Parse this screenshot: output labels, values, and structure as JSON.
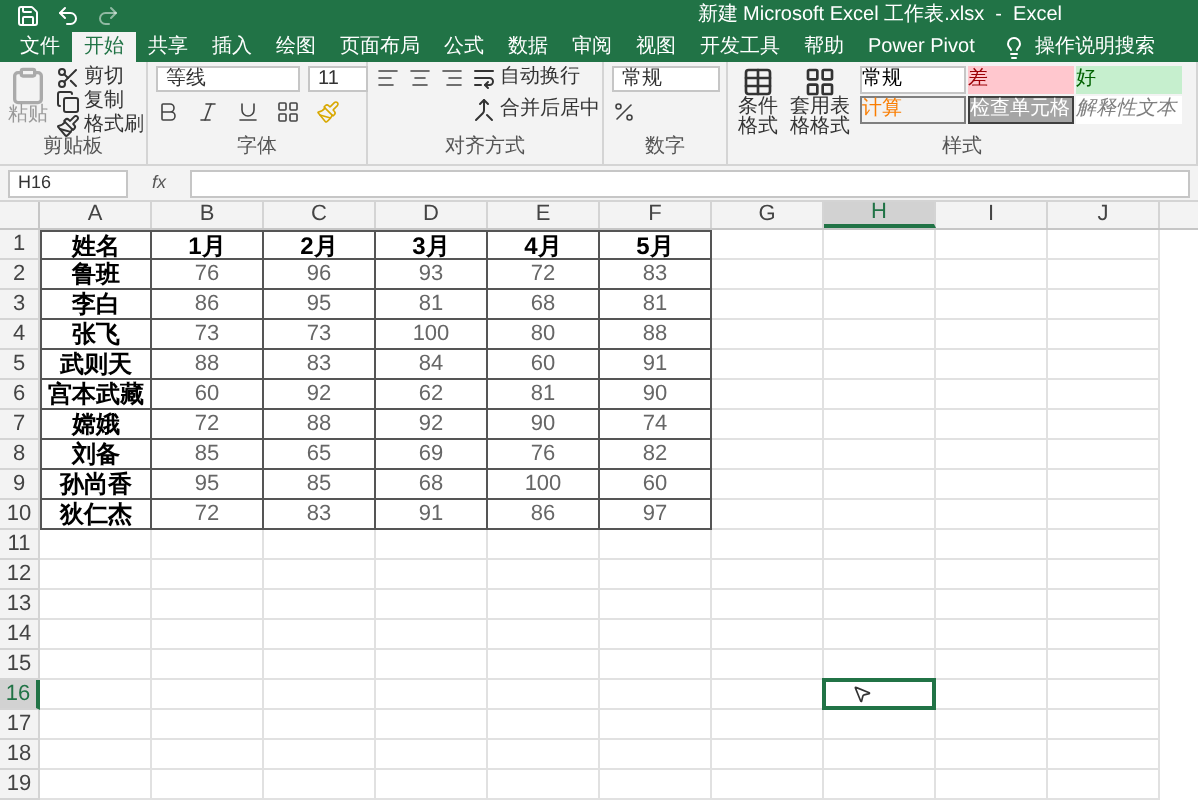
{
  "window": {
    "title": "新建 Microsoft Excel 工作表.xlsx  -  Excel"
  },
  "tabs": [
    {
      "label": "文件",
      "selected": false
    },
    {
      "label": "开始",
      "selected": true
    },
    {
      "label": "共享",
      "selected": false
    },
    {
      "label": "插入",
      "selected": false
    },
    {
      "label": "绘图",
      "selected": false
    },
    {
      "label": "页面布局",
      "selected": false
    },
    {
      "label": "公式",
      "selected": false
    },
    {
      "label": "数据",
      "selected": false
    },
    {
      "label": "审阅",
      "selected": false
    },
    {
      "label": "视图",
      "selected": false
    },
    {
      "label": "开发工具",
      "selected": false
    },
    {
      "label": "帮助",
      "selected": false
    },
    {
      "label": "Power Pivot",
      "selected": false
    }
  ],
  "search": {
    "placeholder": "操作说明搜索"
  },
  "ribbon": {
    "clipboard": {
      "label": "剪贴板",
      "paste": "粘贴",
      "cut": "剪切",
      "copy": "复制",
      "format_painter": "格式刷"
    },
    "font": {
      "label": "字体",
      "font_name": "等线",
      "font_size": "11"
    },
    "alignment": {
      "label": "对齐方式",
      "wrap_text": "自动换行",
      "merge_center": "合并后居中"
    },
    "number": {
      "label": "数字",
      "format": "常规"
    },
    "styles": {
      "label": "样式",
      "conditional_format": "条件格式",
      "table_format": "套用表格格式",
      "tiles": [
        {
          "label": "常规",
          "kind": "normal"
        },
        {
          "label": "差",
          "kind": "bad"
        },
        {
          "label": "好",
          "kind": "good"
        },
        {
          "label": "计算",
          "kind": "calculation"
        },
        {
          "label": "检查单元格",
          "kind": "check"
        },
        {
          "label": "解释性文本",
          "kind": "explanatory"
        }
      ]
    }
  },
  "name_box": {
    "value": "H16"
  },
  "formula_bar": {
    "function_label": "fx"
  },
  "sheet": {
    "columns": [
      {
        "label": "A",
        "selected": false
      },
      {
        "label": "B",
        "selected": false
      },
      {
        "label": "C",
        "selected": false
      },
      {
        "label": "D",
        "selected": false
      },
      {
        "label": "E",
        "selected": false
      },
      {
        "label": "F",
        "selected": false
      },
      {
        "label": "G",
        "selected": false
      },
      {
        "label": "H",
        "selected": true
      },
      {
        "label": "I",
        "selected": false
      },
      {
        "label": "J",
        "selected": false
      }
    ],
    "rows": [
      {
        "header": "1",
        "selected": false,
        "cells": [
          "姓名",
          "1月",
          "2月",
          "3月",
          "4月",
          "5月"
        ]
      },
      {
        "header": "2",
        "selected": false,
        "cells": [
          "鲁班",
          "76",
          "96",
          "93",
          "72",
          "83"
        ]
      },
      {
        "header": "3",
        "selected": false,
        "cells": [
          "李白",
          "86",
          "95",
          "81",
          "68",
          "81"
        ]
      },
      {
        "header": "4",
        "selected": false,
        "cells": [
          "张飞",
          "73",
          "73",
          "100",
          "80",
          "88"
        ]
      },
      {
        "header": "5",
        "selected": false,
        "cells": [
          "武则天",
          "88",
          "83",
          "84",
          "60",
          "91"
        ]
      },
      {
        "header": "6",
        "selected": false,
        "cells": [
          "宫本武藏",
          "60",
          "92",
          "62",
          "81",
          "90"
        ]
      },
      {
        "header": "7",
        "selected": false,
        "cells": [
          "嫦娥",
          "72",
          "88",
          "92",
          "90",
          "74"
        ]
      },
      {
        "header": "8",
        "selected": false,
        "cells": [
          "刘备",
          "85",
          "65",
          "69",
          "76",
          "82"
        ]
      },
      {
        "header": "9",
        "selected": false,
        "cells": [
          "孙尚香",
          "95",
          "85",
          "68",
          "100",
          "60"
        ]
      },
      {
        "header": "10",
        "selected": false,
        "cells": [
          "狄仁杰",
          "72",
          "83",
          "91",
          "86",
          "97"
        ]
      },
      {
        "header": "11",
        "selected": false
      },
      {
        "header": "12",
        "selected": false
      },
      {
        "header": "13",
        "selected": false
      },
      {
        "header": "14",
        "selected": false
      },
      {
        "header": "15",
        "selected": false
      },
      {
        "header": "16",
        "selected": true
      },
      {
        "header": "17",
        "selected": false
      },
      {
        "header": "18",
        "selected": false
      },
      {
        "header": "19",
        "selected": false
      }
    ]
  }
}
